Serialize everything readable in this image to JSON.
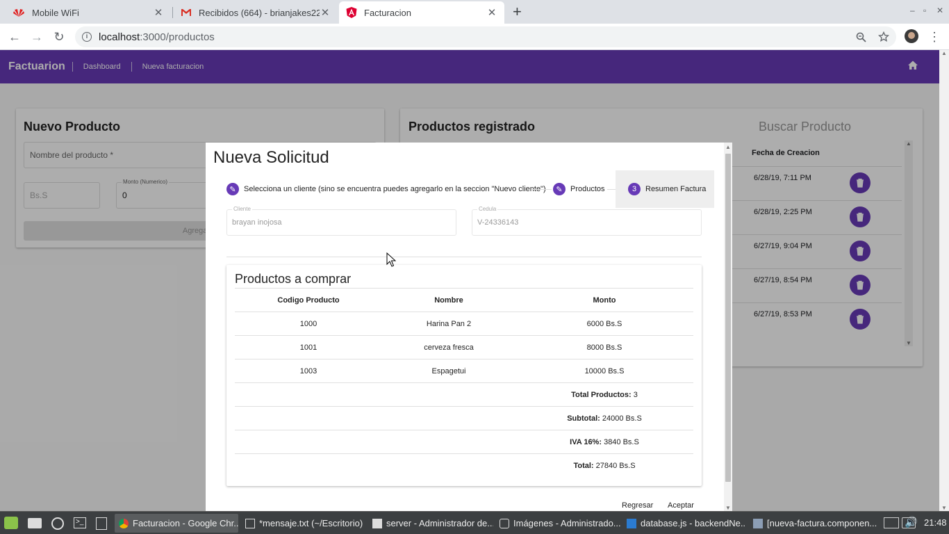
{
  "browser": {
    "tabs": [
      {
        "label": "Mobile WiFi"
      },
      {
        "label": "Recibidos (664) - brianjakes22@"
      },
      {
        "label": "Facturacion"
      }
    ],
    "url_host": "localhost",
    "url_path": ":3000/productos"
  },
  "app": {
    "brand": "Factuarion",
    "nav": [
      "Dashboard",
      "Nueva facturacion"
    ]
  },
  "left_card": {
    "title": "Nuevo Producto",
    "name_placeholder": "Nombre del producto *",
    "currency": "Bs.S",
    "amount_label": "Monto (Numerico)",
    "amount_value": "0",
    "add_button": "Agregar C"
  },
  "right_card": {
    "title": "Productos registrado",
    "search_title": "Buscar Producto",
    "date_header": "Fecha de Creacion",
    "dates": [
      "6/28/19, 7:11 PM",
      "6/28/19, 2:25 PM",
      "6/27/19, 9:04 PM",
      "6/27/19, 8:54 PM",
      "6/27/19, 8:53 PM"
    ]
  },
  "dialog": {
    "title": "Nueva Solicitud",
    "steps": [
      {
        "label": "Selecciona un cliente (sino se encuentra puedes agregarlo en la seccion \"Nuevo cliente\")"
      },
      {
        "label": "Productos"
      },
      {
        "num": "3",
        "label": "Resumen Factura"
      }
    ],
    "client_label": "Cliente",
    "client_value": "brayan inojosa",
    "id_label": "Cedula",
    "id_value": "V-24336143",
    "products_title": "Productos a comprar",
    "columns": [
      "Codigo Producto",
      "Nombre",
      "Monto"
    ],
    "rows": [
      {
        "code": "1000",
        "name": "Harina Pan 2",
        "amount": "6000 Bs.S"
      },
      {
        "code": "1001",
        "name": "cerveza fresca",
        "amount": "8000 Bs.S"
      },
      {
        "code": "1003",
        "name": "Espagetui",
        "amount": "10000 Bs.S"
      }
    ],
    "totals": [
      {
        "label": "Total Productos:",
        "value": " 3"
      },
      {
        "label": "Subtotal:",
        "value": " 24000 Bs.S"
      },
      {
        "label": "IVA 16%:",
        "value": " 3840 Bs.S"
      },
      {
        "label": "Total:",
        "value": " 27840 Bs.S"
      }
    ],
    "back_button": "Regresar",
    "accept_button": "Aceptar"
  },
  "taskbar": {
    "tasks": [
      "Facturacion - Google Chr...",
      "*mensaje.txt (~/Escritorio)",
      "server - Administrador de...",
      "Imágenes - Administrado...",
      "database.js - backendNe...",
      "[nueva-factura.componen..."
    ],
    "clock": "21:48"
  },
  "colors": {
    "primary": "#673ab7"
  }
}
